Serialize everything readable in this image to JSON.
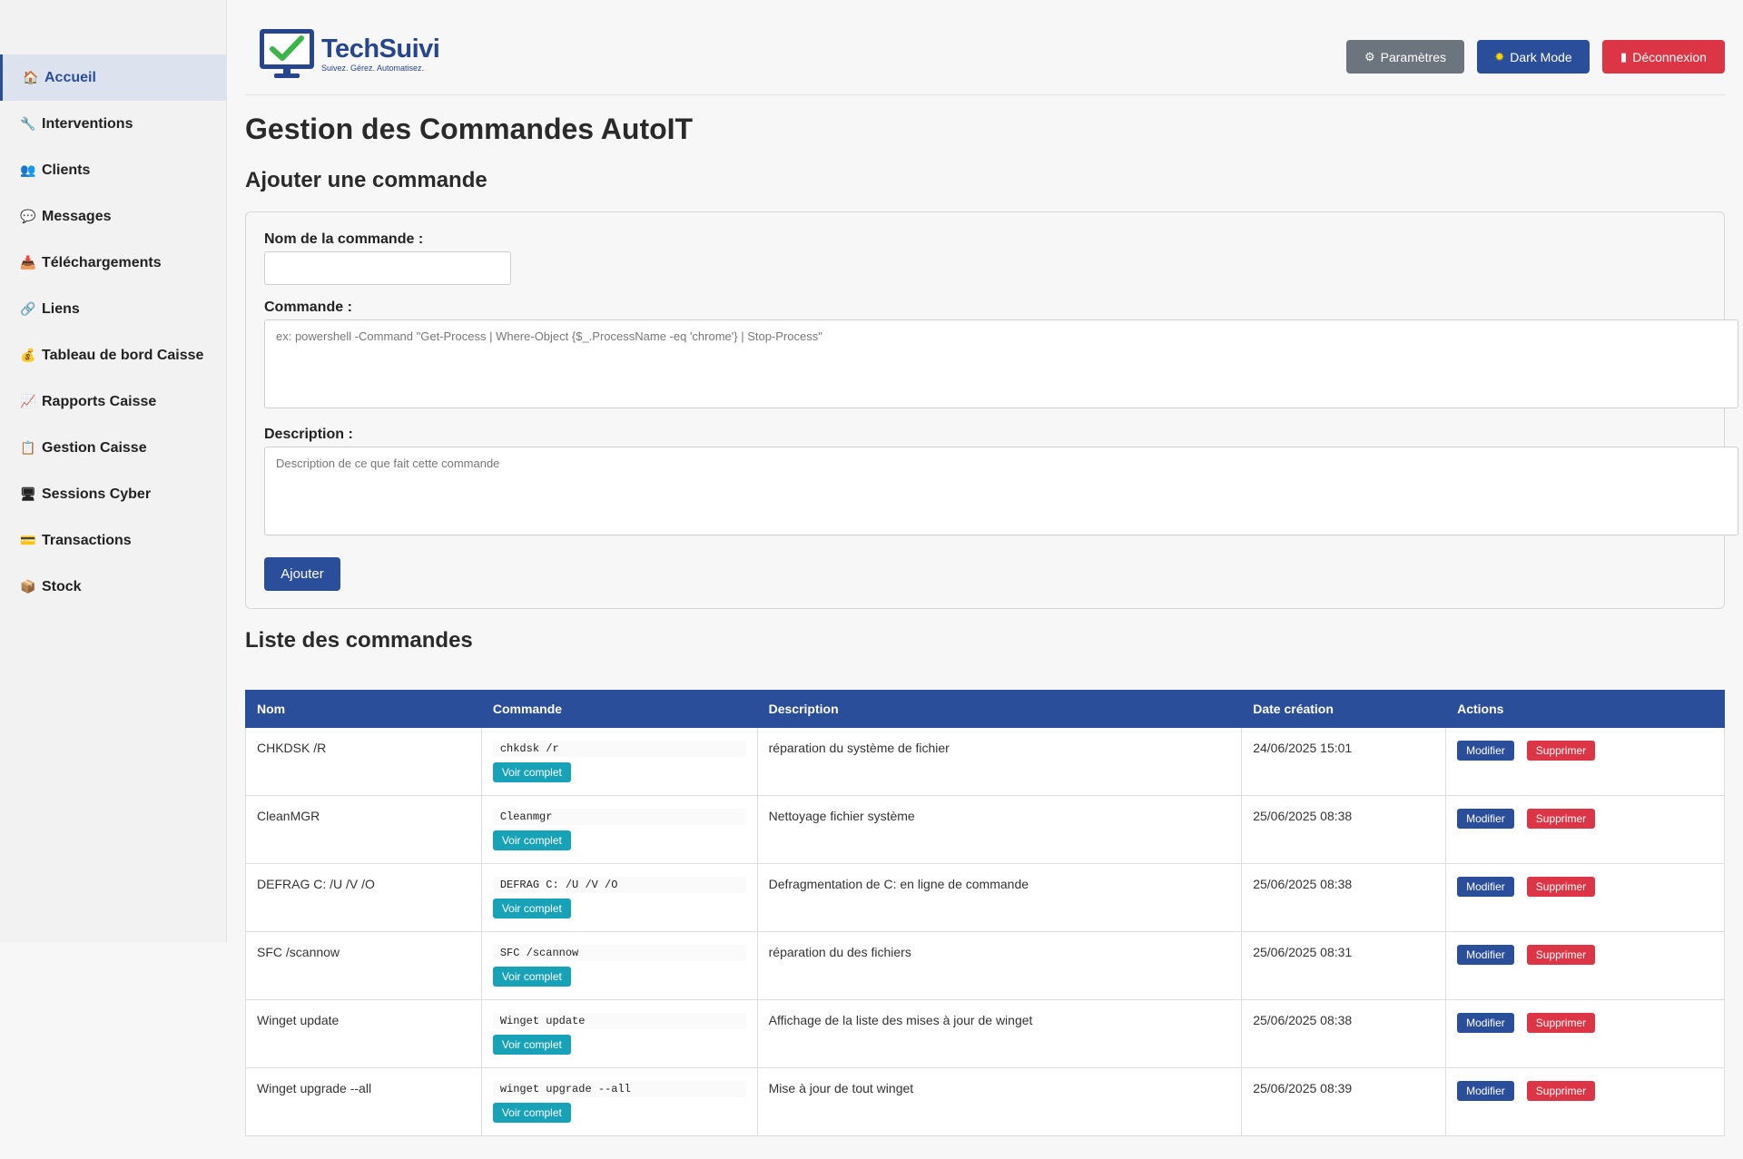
{
  "sidebar": {
    "items": [
      {
        "label": "Accueil",
        "icon": "home-icon",
        "glyph": "🏠",
        "active": true
      },
      {
        "label": "Interventions",
        "icon": "wrench-icon",
        "glyph": "🔧"
      },
      {
        "label": "Clients",
        "icon": "users-icon",
        "glyph": "👥"
      },
      {
        "label": "Messages",
        "icon": "chat-icon",
        "glyph": "💬"
      },
      {
        "label": "Téléchargements",
        "icon": "download-icon",
        "glyph": "📥"
      },
      {
        "label": "Liens",
        "icon": "link-icon",
        "glyph": "🔗"
      },
      {
        "label": "Tableau de bord Caisse",
        "icon": "money-bag-icon",
        "glyph": "💰"
      },
      {
        "label": "Rapports Caisse",
        "icon": "chart-icon",
        "glyph": "📈"
      },
      {
        "label": "Gestion Caisse",
        "icon": "clipboard-icon",
        "glyph": "📋"
      },
      {
        "label": "Sessions Cyber",
        "icon": "monitor-icon",
        "glyph": "🖥"
      },
      {
        "label": "Transactions",
        "icon": "card-icon",
        "glyph": "💳"
      },
      {
        "label": "Stock",
        "icon": "box-icon",
        "glyph": "📦"
      }
    ]
  },
  "header": {
    "logo_title": "TechSuivi",
    "logo_tagline": "Suivez. Gérez. Automatisez.",
    "settings_label": "Paramètres",
    "darkmode_label": "Dark Mode",
    "logout_label": "Déconnexion"
  },
  "page": {
    "title": "Gestion des Commandes AutoIT",
    "add_section_title": "Ajouter une commande",
    "list_section_title": "Liste des commandes"
  },
  "form": {
    "name_label": "Nom de la commande :",
    "name_value": "",
    "command_label": "Commande :",
    "command_placeholder": "ex: powershell -Command \"Get-Process | Where-Object {$_.ProcessName -eq 'chrome'} | Stop-Process\"",
    "description_label": "Description :",
    "description_placeholder": "Description de ce que fait cette commande",
    "submit_label": "Ajouter"
  },
  "table": {
    "headers": [
      "Nom",
      "Commande",
      "Description",
      "Date création",
      "Actions"
    ],
    "view_label": "Voir complet",
    "edit_label": "Modifier",
    "delete_label": "Supprimer",
    "rows": [
      {
        "name": "CHKDSK /R",
        "command": "chkdsk /r",
        "description": "réparation du système de fichier",
        "date": "24/06/2025 15:01"
      },
      {
        "name": "CleanMGR",
        "command": "Cleanmgr",
        "description": "Nettoyage fichier système",
        "date": "25/06/2025 08:38"
      },
      {
        "name": "DEFRAG C: /U /V /O",
        "command": "DEFRAG C: /U /V /O",
        "description": "Defragmentation de C: en ligne de commande",
        "date": "25/06/2025 08:38"
      },
      {
        "name": "SFC /scannow",
        "command": "SFC /scannow",
        "description": "réparation du des fichiers",
        "date": "25/06/2025 08:31"
      },
      {
        "name": "Winget update",
        "command": "Winget update",
        "description": "Affichage de la liste des mises à jour de winget",
        "date": "25/06/2025 08:38"
      },
      {
        "name": "Winget upgrade --all",
        "command": "winget upgrade --all",
        "description": "Mise à jour de tout winget",
        "date": "25/06/2025 08:39"
      }
    ]
  },
  "colors": {
    "primary": "#2b4e9b",
    "danger": "#dc3545",
    "info": "#17a2b8",
    "secondary": "#6c757d"
  }
}
